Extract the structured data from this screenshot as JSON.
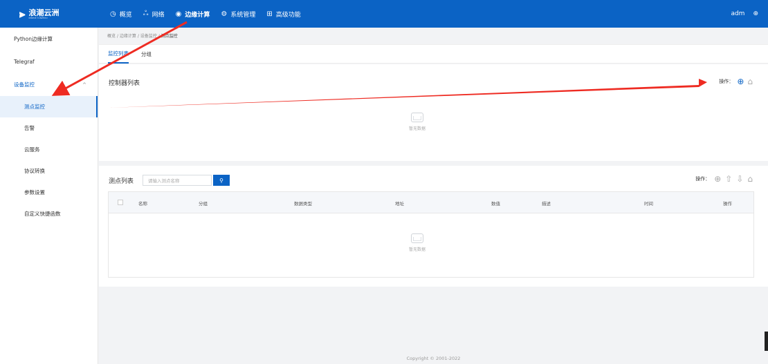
{
  "brand": {
    "logo_cn": "浪潮云洲",
    "logo_en": "INSPUR YUNZHOU"
  },
  "nav": [
    {
      "label": "概览",
      "icon": "dashboard-icon"
    },
    {
      "label": "网络",
      "icon": "network-icon"
    },
    {
      "label": "边缘计算",
      "icon": "edge-compute-icon"
    },
    {
      "label": "系统管理",
      "icon": "settings-icon"
    },
    {
      "label": "高级功能",
      "icon": "grid-icon"
    }
  ],
  "user": {
    "name": "adm"
  },
  "sidebar": {
    "items": [
      {
        "label": "Python边缘计算"
      },
      {
        "label": "Telegraf"
      },
      {
        "label": "设备监控"
      },
      {
        "label": "测点监控"
      },
      {
        "label": "告警"
      },
      {
        "label": "云服务"
      },
      {
        "label": "协议转换"
      },
      {
        "label": "参数设置"
      },
      {
        "label": "自定义快捷函数"
      }
    ]
  },
  "breadcrumb": [
    "概览",
    "边缘计算",
    "设备监控",
    "测点监控"
  ],
  "breadcrumb_sep": "/",
  "tabs": [
    {
      "label": "监控列表"
    },
    {
      "label": "分组"
    }
  ],
  "controller": {
    "title": "控制器列表",
    "op_label": "操作：",
    "empty": "暂无数据"
  },
  "points": {
    "title": "测点列表",
    "search_placeholder": "请输入测点名称",
    "op_label": "操作：",
    "columns": [
      "名称",
      "分组",
      "数据类型",
      "地址",
      "数值",
      "描述",
      "时间",
      "操作"
    ],
    "empty": "暂无数据"
  },
  "footer": {
    "copyright": "Copyright © 2001-2022"
  },
  "colors": {
    "primary": "#0b63c5",
    "annotation": "#ee2b22"
  }
}
